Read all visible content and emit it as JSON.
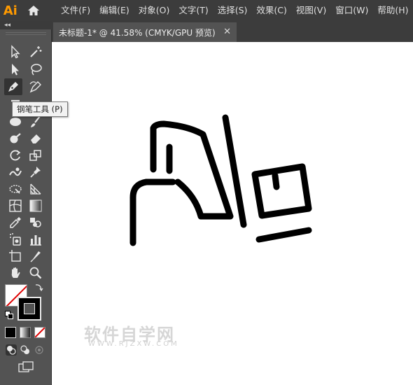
{
  "app": {
    "logo": "Ai",
    "colors": {
      "logo": "#ff9a00",
      "chrome": "#535353",
      "menubar": "#3c3c3c"
    }
  },
  "menu": {
    "items": [
      "文件(F)",
      "编辑(E)",
      "对象(O)",
      "文字(T)",
      "选择(S)",
      "效果(C)",
      "视图(V)",
      "窗口(W)",
      "帮助(H)"
    ]
  },
  "document_tab": {
    "title": "未标题-1* @ 41.58% (CMYK/GPU 预览)",
    "close": "✕"
  },
  "tooltip": {
    "text": "钢笔工具 (P)"
  },
  "toolbar": {
    "collapse": "◂◂",
    "tools": [
      {
        "name": "selection-tool",
        "icon": "selection-arrow-icon"
      },
      {
        "name": "magic-wand-tool",
        "icon": "magic-wand-icon"
      },
      {
        "name": "direct-selection-tool",
        "icon": "direct-selection-arrow-icon"
      },
      {
        "name": "lasso-tool",
        "icon": "lasso-icon"
      },
      {
        "name": "pen-tool",
        "icon": "pen-icon"
      },
      {
        "name": "curvature-tool",
        "icon": "curvature-pen-icon"
      },
      {
        "name": "type-tool",
        "icon": "type-icon"
      },
      {
        "name": "ellipse-tool",
        "icon": "ellipse-icon"
      },
      {
        "name": "paintbrush-tool",
        "icon": "paintbrush-icon"
      },
      {
        "name": "shaper-tool",
        "icon": "shaper-icon"
      },
      {
        "name": "eraser-tool",
        "icon": "eraser-icon"
      },
      {
        "name": "rotate-tool",
        "icon": "rotate-icon"
      },
      {
        "name": "scale-tool",
        "icon": "scale-icon"
      },
      {
        "name": "warp-tool",
        "icon": "warp-icon"
      },
      {
        "name": "puppet-warp-tool",
        "icon": "puppet-pin-icon"
      },
      {
        "name": "free-transform-tool",
        "icon": "free-transform-icon"
      },
      {
        "name": "perspective-grid-tool",
        "icon": "perspective-grid-icon"
      },
      {
        "name": "mesh-tool",
        "icon": "mesh-icon"
      },
      {
        "name": "gradient-tool",
        "icon": "gradient-icon"
      },
      {
        "name": "eyedropper-tool",
        "icon": "eyedropper-icon"
      },
      {
        "name": "blend-tool",
        "icon": "blend-icon"
      },
      {
        "name": "symbol-sprayer-tool",
        "icon": "symbol-sprayer-icon"
      },
      {
        "name": "column-graph-tool",
        "icon": "column-graph-icon"
      },
      {
        "name": "artboard-tool",
        "icon": "artboard-icon"
      },
      {
        "name": "slice-tool",
        "icon": "slice-icon"
      },
      {
        "name": "hand-tool",
        "icon": "hand-icon"
      },
      {
        "name": "zoom-tool",
        "icon": "zoom-icon"
      }
    ],
    "fill": "none",
    "stroke": "#000000"
  },
  "watermark": {
    "title": "软件自学网",
    "subtitle": "WWW.RJZXW.COM"
  }
}
